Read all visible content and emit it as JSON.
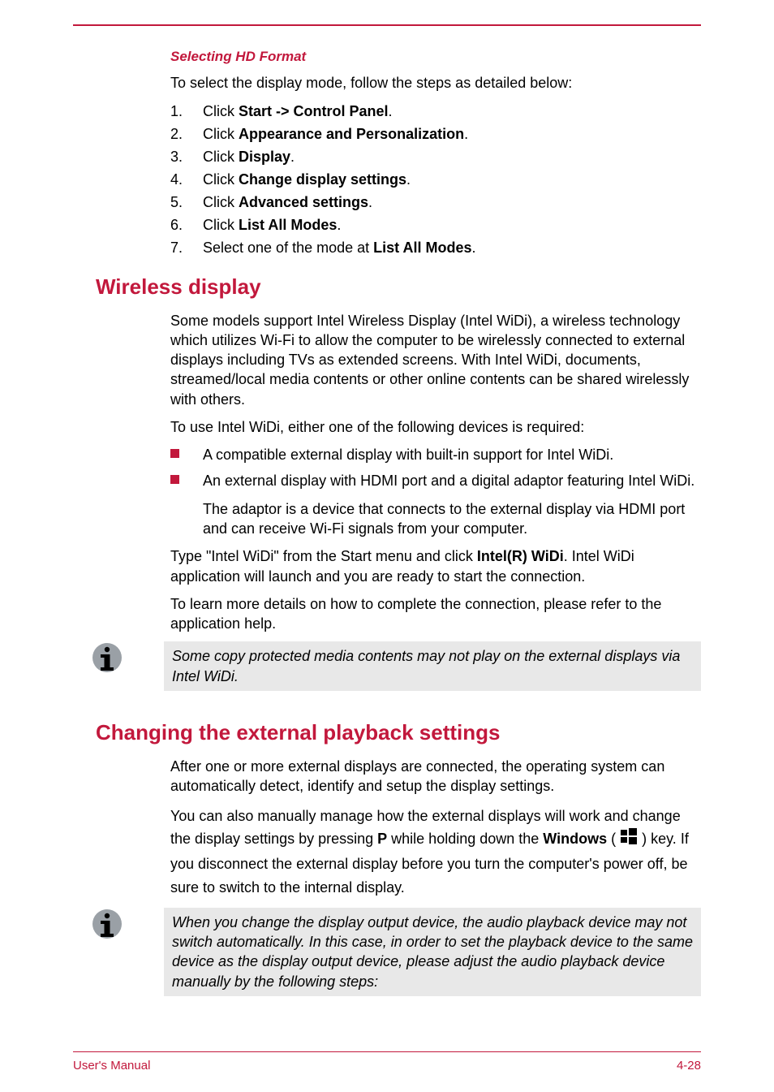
{
  "section_sub": "Selecting HD Format",
  "intro_select": "To select the display mode, follow the steps as detailed below:",
  "steps": [
    {
      "pre": "Click ",
      "bold": "Start -> Control Panel",
      "post": "."
    },
    {
      "pre": "Click ",
      "bold": "Appearance and Personalization",
      "post": "."
    },
    {
      "pre": "Click ",
      "bold": "Display",
      "post": "."
    },
    {
      "pre": "Click ",
      "bold": "Change display settings",
      "post": "."
    },
    {
      "pre": "Click ",
      "bold": "Advanced settings",
      "post": "."
    },
    {
      "pre": "Click ",
      "bold": "List All Modes",
      "post": "."
    },
    {
      "pre": "Select one of the mode at ",
      "bold": "List All Modes",
      "post": "."
    }
  ],
  "h_wireless": "Wireless display",
  "wd_p1": "Some models support Intel Wireless Display (Intel WiDi), a wireless technology which utilizes Wi-Fi to allow the computer to be wirelessly connected to external displays including TVs as extended screens. With Intel WiDi, documents, streamed/local media contents or other online contents can be shared wirelessly with others.",
  "wd_p2": "To use Intel WiDi, either one of the following devices is required:",
  "wd_bullets": [
    "A compatible external display with built-in support for Intel WiDi.",
    "An external display with HDMI port and a digital adaptor featuring Intel WiDi."
  ],
  "wd_sub": "The adaptor is a device that connects to the external display via HDMI port and can receive Wi-Fi signals from your computer.",
  "wd_p3_pre": "Type \"Intel WiDi\" from the Start menu and click ",
  "wd_p3_bold": "Intel(R) WiDi",
  "wd_p3_post": ". Intel WiDi application will launch and you are ready to start the connection.",
  "wd_p4": "To learn more details on how to complete the connection, please refer to the application help.",
  "note1": "Some copy protected media contents may not play on the external displays via Intel WiDi.",
  "h_changing": "Changing the external playback settings",
  "ch_p1": "After one or more external displays are connected, the operating system can automatically detect, identify and setup the display settings.",
  "ch_p2_a": "You can also manually manage how the external displays will work and change the display settings by pressing ",
  "ch_p2_P": "P",
  "ch_p2_b": " while holding down the ",
  "ch_p2_win": "Windows",
  "ch_p2_c": " ) key. If you disconnect the external display before you turn the computer's power off, be sure to switch to the internal display.",
  "note2": "When you change the display output device, the audio playback device may not switch automatically. In this case, in order to set the playback device to the same device as the display output device, please adjust the audio playback device manually by the following steps:",
  "footer_left": "User's Manual",
  "footer_right": "4-28"
}
